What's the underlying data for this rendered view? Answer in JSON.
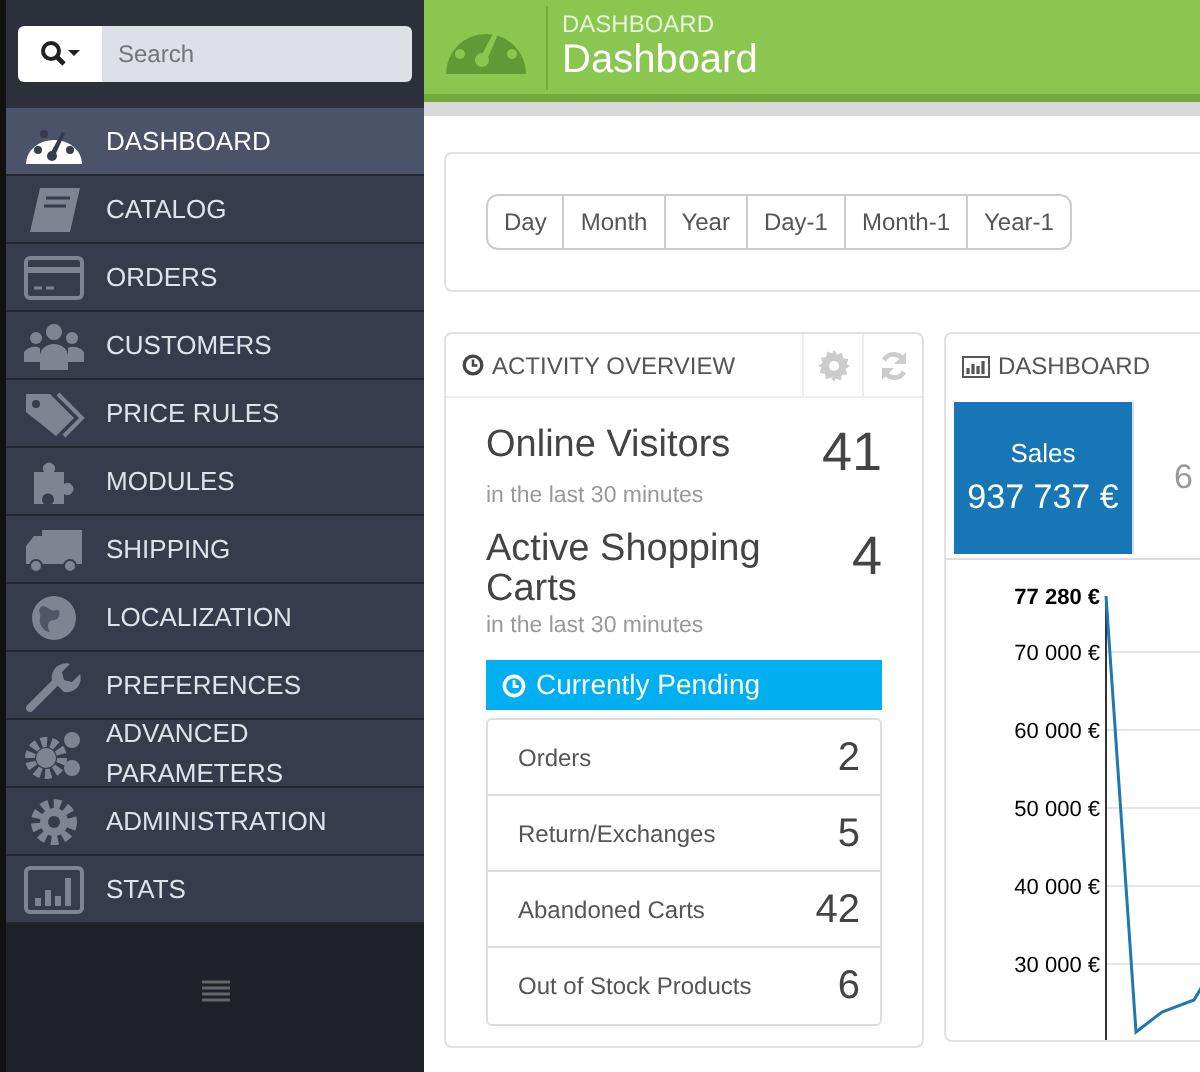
{
  "search": {
    "placeholder": "Search"
  },
  "sidebar": {
    "items": [
      {
        "label": "DASHBOARD",
        "selected": true
      },
      {
        "label": "CATALOG",
        "selected": false
      },
      {
        "label": "ORDERS",
        "selected": false
      },
      {
        "label": "CUSTOMERS",
        "selected": false
      },
      {
        "label": "PRICE RULES",
        "selected": false
      },
      {
        "label": "MODULES",
        "selected": false
      },
      {
        "label": "SHIPPING",
        "selected": false
      },
      {
        "label": "LOCALIZATION",
        "selected": false
      },
      {
        "label": "PREFERENCES",
        "selected": false
      },
      {
        "label": "ADVANCED PARAMETERS",
        "selected": false
      },
      {
        "label": "ADMINISTRATION",
        "selected": false
      },
      {
        "label": "STATS",
        "selected": false
      }
    ]
  },
  "header": {
    "breadcrumb": "DASHBOARD",
    "title": "Dashboard"
  },
  "period_buttons": [
    {
      "label": "Day",
      "selected": false
    },
    {
      "label": "Month",
      "selected": false
    },
    {
      "label": "Year",
      "selected": false
    },
    {
      "label": "Day-1",
      "selected": false
    },
    {
      "label": "Month-1",
      "selected": false
    },
    {
      "label": "Year-1",
      "selected": false
    }
  ],
  "activity": {
    "title": "ACTIVITY OVERVIEW",
    "metrics": [
      {
        "label": "Online Visitors",
        "value": "41",
        "note": "in the last 30 minutes"
      },
      {
        "label": "Active Shopping Carts",
        "value": "4",
        "note": "in the last 30 minutes"
      }
    ],
    "pending": {
      "title": "Currently Pending",
      "rows": [
        {
          "label": "Orders",
          "value": "2"
        },
        {
          "label": "Return/Exchanges",
          "value": "5"
        },
        {
          "label": "Abandoned Carts",
          "value": "42"
        },
        {
          "label": "Out of Stock Products",
          "value": "6"
        }
      ]
    }
  },
  "dashboard": {
    "title": "DASHBOARD",
    "tiles": [
      {
        "label": "Sales",
        "value": "937 737 €",
        "selected": true
      },
      {
        "value": "6",
        "selected": false
      }
    ],
    "chart": {
      "y_labels": [
        "77 280 €",
        "70 000 €",
        "60 000 €",
        "50 000 €",
        "40 000 €",
        "30 000 €"
      ]
    }
  }
}
